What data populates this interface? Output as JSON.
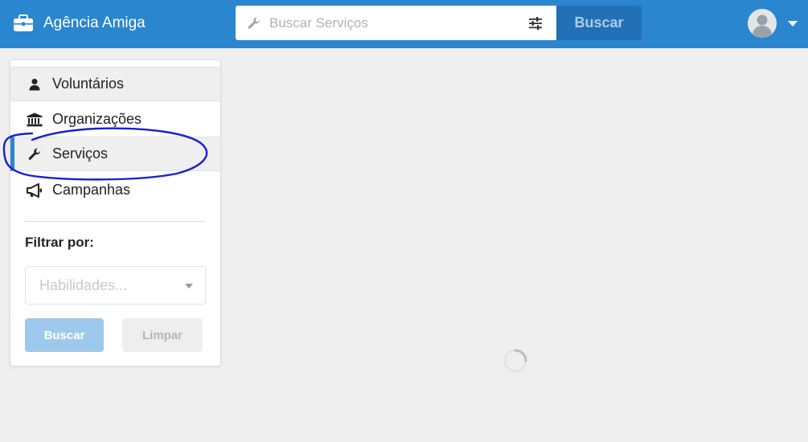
{
  "header": {
    "brand_icon": "briefcase-icon",
    "brand_name": "Agência Amiga",
    "search_icon": "wrench-icon",
    "search_placeholder": "Buscar Serviços",
    "filter_icon": "sliders-icon",
    "search_button": "Buscar",
    "avatar_icon": "user-avatar-icon",
    "menu_caret_icon": "caret-down-icon",
    "colors": {
      "bar": "#2a86cf",
      "search_button": "#2270b5"
    }
  },
  "sidebar": {
    "items": [
      {
        "label": "Voluntários",
        "icon": "user-icon",
        "shaded": true,
        "active": false
      },
      {
        "label": "Organizações",
        "icon": "institution-icon",
        "shaded": false,
        "active": false
      },
      {
        "label": "Serviços",
        "icon": "wrench-icon",
        "shaded": true,
        "active": true
      },
      {
        "label": "Campanhas",
        "icon": "bullhorn-icon",
        "shaded": false,
        "active": false
      }
    ],
    "filter_label": "Filtrar por:",
    "skills_placeholder": "Habilidades...",
    "search_button": "Buscar",
    "clear_button": "Limpar",
    "active_color": "#2a86cf"
  },
  "main": {
    "loading_icon": "loading-spinner-icon",
    "annotation": "hand-drawn-circle"
  }
}
